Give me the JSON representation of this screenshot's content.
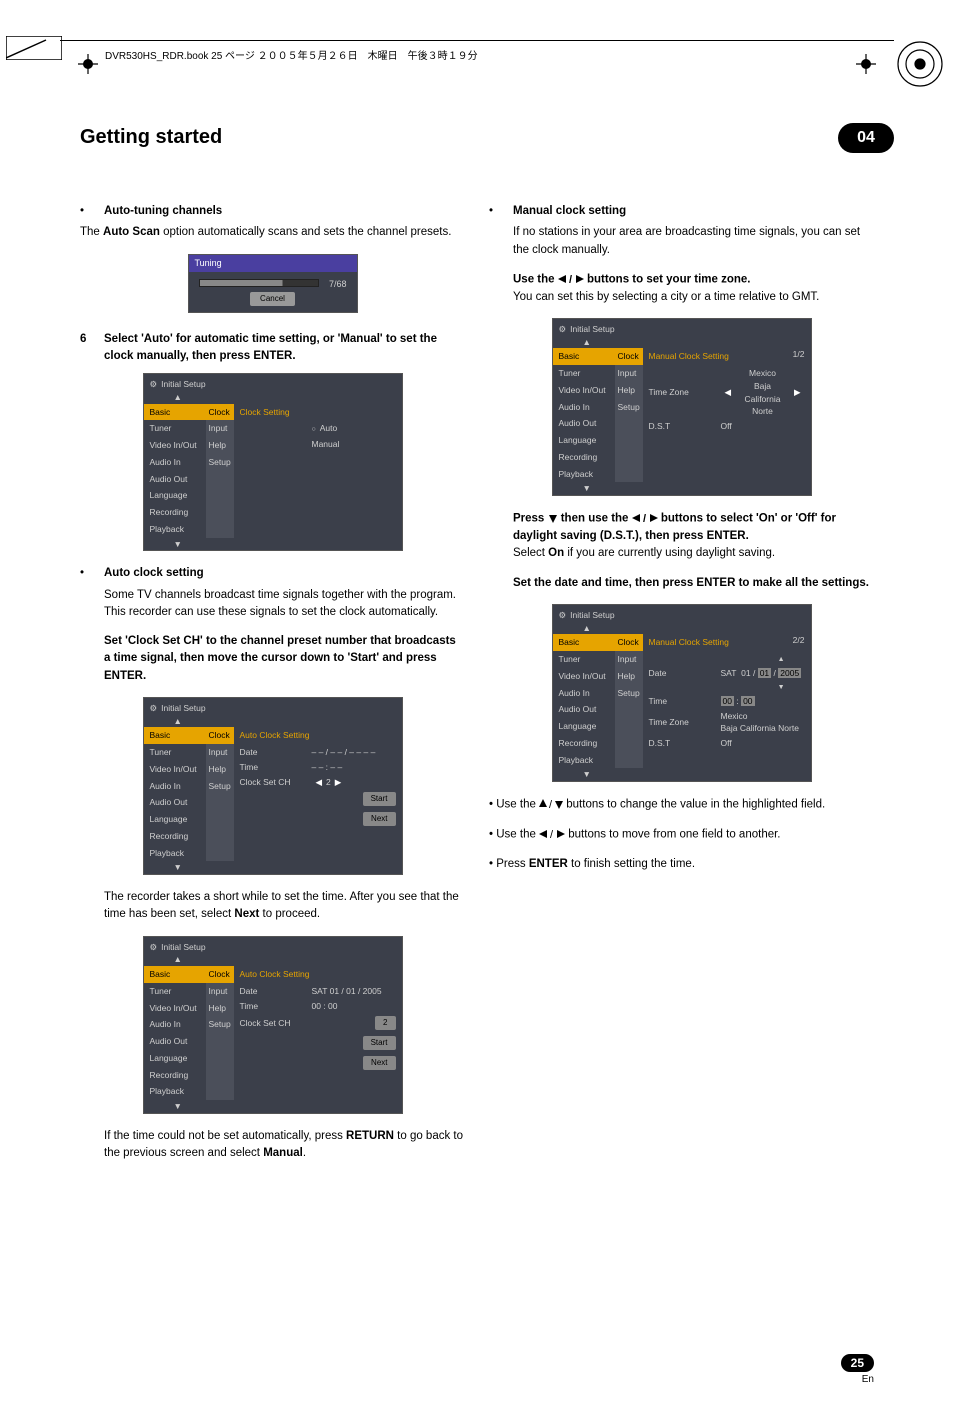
{
  "header": {
    "line": "DVR530HS_RDR.book 25 ページ ２００５年５月２６日　木曜日　午後３時１９分"
  },
  "section": {
    "title": "Getting started",
    "chapter": "04"
  },
  "left": {
    "auto_tuning": {
      "heading": "Auto-tuning channels",
      "body_pre": "The ",
      "body_bold": "Auto Scan",
      "body_post": " option automatically scans and sets the channel presets."
    },
    "tuning_box": {
      "title": "Tuning",
      "progress": "7/68",
      "cancel": "Cancel"
    },
    "step6": {
      "num": "6",
      "text": "Select 'Auto' for automatic time setting, or 'Manual' to set the clock manually, then press ENTER."
    },
    "setup1": {
      "label": "Initial Setup",
      "side": [
        "Basic",
        "Tuner",
        "Video In/Out",
        "Audio In",
        "Audio Out",
        "Language",
        "Recording",
        "Playback"
      ],
      "tabs": [
        "Clock",
        "Input",
        "Help",
        "Setup"
      ],
      "hd": "Clock Setting",
      "opt_auto": "Auto",
      "opt_manual": "Manual"
    },
    "auto_clock": {
      "heading": "Auto clock setting",
      "body": "Some TV channels broadcast time signals together with the program. This recorder can use these signals to set the clock automatically.",
      "bold": "Set 'Clock Set CH' to the channel preset number that broadcasts a time signal, then move the cursor down to 'Start' and press ENTER."
    },
    "setup2": {
      "label": "Initial Setup",
      "side": [
        "Basic",
        "Tuner",
        "Video In/Out",
        "Audio In",
        "Audio Out",
        "Language",
        "Recording",
        "Playback"
      ],
      "tabs": [
        "Clock",
        "Input",
        "Help",
        "Setup"
      ],
      "hd": "Auto Clock Setting",
      "rows": {
        "date_lbl": "Date",
        "date_val": "– – / – – / – – – –",
        "time_lbl": "Time",
        "time_val": "– – : – –",
        "ch_lbl": "Clock Set CH",
        "ch_val": "2",
        "start": "Start",
        "next": "Next"
      }
    },
    "rec_next": {
      "pre": "The recorder takes a short while to set the time. After you see that the time has been set, select ",
      "bold": "Next",
      "post": " to proceed."
    },
    "setup3": {
      "label": "Initial Setup",
      "side": [
        "Basic",
        "Tuner",
        "Video In/Out",
        "Audio In",
        "Audio Out",
        "Language",
        "Recording",
        "Playback"
      ],
      "tabs": [
        "Clock",
        "Input",
        "Help",
        "Setup"
      ],
      "hd": "Auto Clock Setting",
      "rows": {
        "date_lbl": "Date",
        "date_val": "SAT  01 / 01 / 2005",
        "time_lbl": "Time",
        "time_val": "00 : 00",
        "ch_lbl": "Clock Set CH",
        "ch_val": "2",
        "start": "Start",
        "next": "Next"
      }
    },
    "fallback": {
      "pre": "If the time could not be set automatically, press ",
      "bold1": "RETURN",
      "mid": " to go back to the previous screen and select ",
      "bold2": "Manual",
      "post": "."
    }
  },
  "right": {
    "manual": {
      "heading": "Manual clock setting",
      "body": "If no stations in your area are broadcasting time signals, you can set the clock manually."
    },
    "tz": {
      "bold_pre": "Use the ",
      "bold_post": " buttons to set your time zone.",
      "body": "You can set this by selecting a city or a time relative to GMT."
    },
    "setup4": {
      "label": "Initial Setup",
      "side": [
        "Basic",
        "Tuner",
        "Video In/Out",
        "Audio In",
        "Audio Out",
        "Language",
        "Recording",
        "Playback"
      ],
      "tabs": [
        "Clock",
        "Input",
        "Help",
        "Setup"
      ],
      "hd": "Manual Clock Setting",
      "corner": "1/2",
      "tz_lbl": "Time Zone",
      "tz_top": "Mexico",
      "tz_bot": "Baja California Norte",
      "dst_lbl": "D.S.T",
      "dst_val": "Off"
    },
    "dst": {
      "bold_pre": "Press ",
      "bold_mid": " then use the ",
      "bold_post": " buttons to select 'On' or 'Off' for daylight saving (D.S.T.), then press ENTER.",
      "body_pre": "Select ",
      "body_bold": "On",
      "body_post": " if you are currently using daylight saving.",
      "set_bold": "Set the date and time, then press ENTER to make all the settings."
    },
    "setup5": {
      "label": "Initial Setup",
      "side": [
        "Basic",
        "Tuner",
        "Video In/Out",
        "Audio In",
        "Audio Out",
        "Language",
        "Recording",
        "Playback"
      ],
      "tabs": [
        "Clock",
        "Input",
        "Help",
        "Setup"
      ],
      "hd": "Manual Clock Setting",
      "corner": "2/2",
      "date_lbl": "Date",
      "date_day": "SAT",
      "date_m": "01",
      "date_d": "01",
      "date_y": "2005",
      "time_lbl": "Time",
      "time_h": "00",
      "time_m": "00",
      "tz_lbl": "Time Zone",
      "tz_top": "Mexico",
      "tz_bot": "Baja California Norte",
      "dst_lbl": "D.S.T",
      "dst_val": "Off"
    },
    "tips": {
      "t1_pre": "Use the ",
      "t1_post": " buttons to change the value in the highlighted field.",
      "t2_pre": "Use the ",
      "t2_post": " buttons to move from one field to another.",
      "t3_pre": "Press ",
      "t3_bold": "ENTER",
      "t3_post": " to finish setting the time."
    }
  },
  "footer": {
    "page": "25",
    "lang": "En"
  }
}
